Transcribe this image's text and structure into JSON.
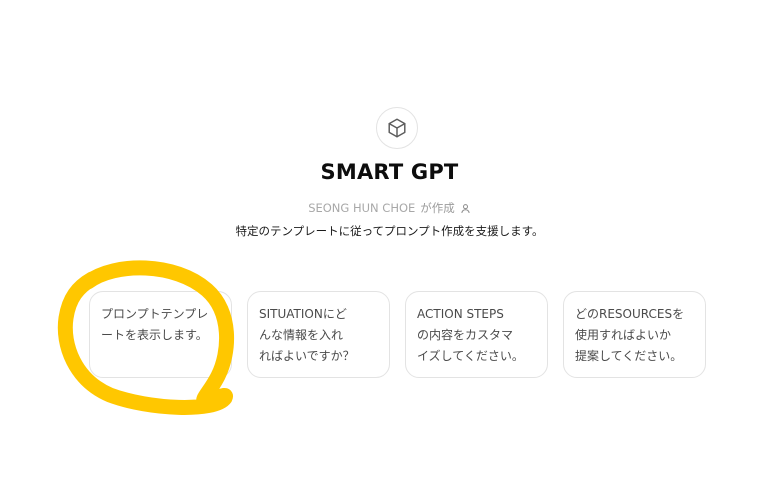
{
  "gpt": {
    "icon": "cube-icon",
    "name": "SMART GPT",
    "author_name": "SEONG HUN CHOE",
    "author_suffix": "が作成",
    "author_icon": "person-icon",
    "description": "特定のテンプレートに従ってプロンプト作成を支援します。"
  },
  "starters": [
    {
      "text": "プロンプトテンプレ\nートを表示します。"
    },
    {
      "text": "SITUATIONにど\nんな情報を入れ\nればよいですか？"
    },
    {
      "text": "ACTION STEPS\nの内容をカスタマ\nイズしてください。"
    },
    {
      "text": "どのRESOURCESを\n使用すればよいか\n提案してください。"
    }
  ],
  "annotation": {
    "type": "hand-drawn-circle",
    "color": "#FFC700"
  }
}
